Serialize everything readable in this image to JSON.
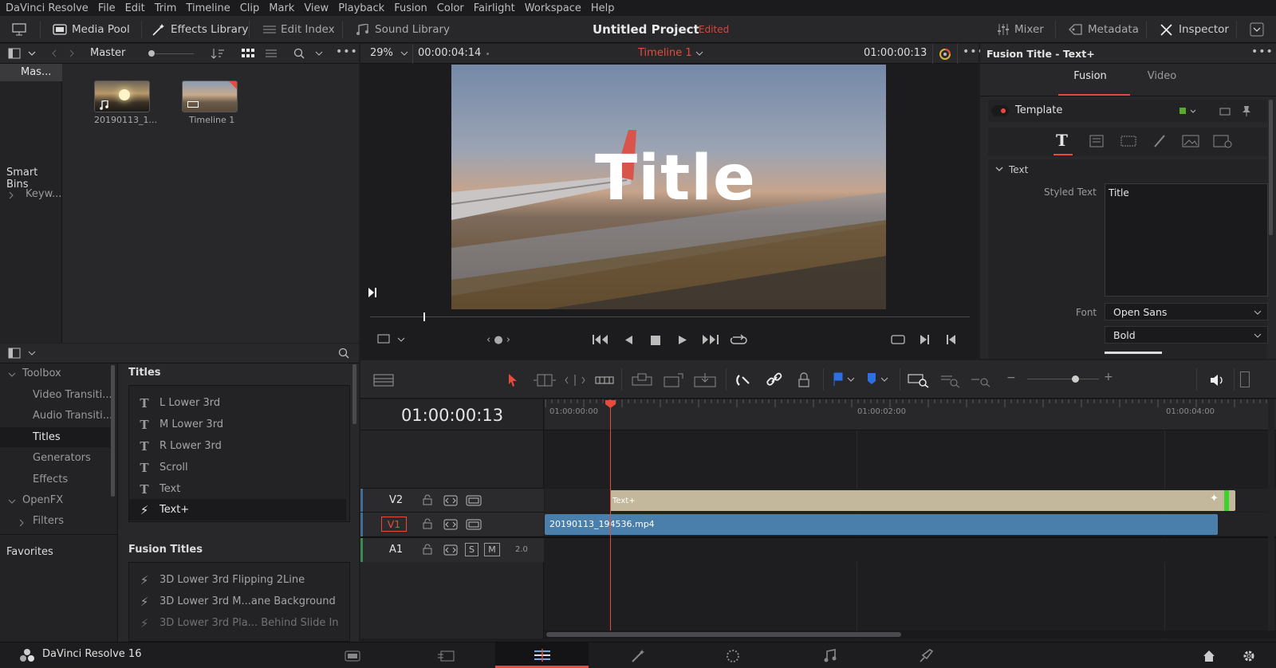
{
  "menu": [
    "DaVinci Resolve",
    "File",
    "Edit",
    "Trim",
    "Timeline",
    "Clip",
    "Mark",
    "View",
    "Playback",
    "Fusion",
    "Color",
    "Fairlight",
    "Workspace",
    "Help"
  ],
  "toolbar": {
    "media_pool": "Media Pool",
    "effects_library": "Effects Library",
    "edit_index": "Edit Index",
    "sound_library": "Sound Library",
    "project_title": "Untitled Project",
    "project_status": "Edited",
    "mixer": "Mixer",
    "metadata": "Metadata",
    "inspector": "Inspector"
  },
  "media_pool": {
    "bin_label": "Master",
    "tree_master": "Mas...",
    "smart_bins": "Smart Bins",
    "keywords": "Keyw...",
    "clips": [
      {
        "name": "20190113_1..."
      },
      {
        "name": "Timeline 1"
      }
    ]
  },
  "viewer": {
    "zoom": "29%",
    "source_timecode": "00:00:04:14",
    "timeline_name": "Timeline 1",
    "record_timecode": "01:00:00:13",
    "overlay_title": "Title"
  },
  "effects_library": {
    "toolbox": "Toolbox",
    "tree": [
      "Video Transiti...",
      "Audio Transiti...",
      "Titles",
      "Generators",
      "Effects"
    ],
    "openfx": "OpenFX",
    "filters": "Filters",
    "favorites": "Favorites",
    "titles_heading": "Titles",
    "titles": [
      "L Lower 3rd",
      "M Lower 3rd",
      "R Lower 3rd",
      "Scroll",
      "Text",
      "Text+"
    ],
    "fusion_titles_heading": "Fusion Titles",
    "fusion_titles": [
      "3D Lower 3rd Flipping 2Line",
      "3D Lower 3rd M...ane Background",
      "3D Lower 3rd Pla... Behind Slide In"
    ]
  },
  "inspector": {
    "title": "Fusion Title - Text+",
    "tab_fusion": "Fusion",
    "tab_video": "Video",
    "template": "Template",
    "section_text": "Text",
    "styled_text_label": "Styled Text",
    "styled_text_value": "Title",
    "font_label": "Font",
    "font_value": "Open Sans",
    "style_value": "Bold"
  },
  "timeline": {
    "timecode": "01:00:00:13",
    "ruler": [
      "01:00:00:00",
      "01:00:02:00",
      "01:00:04:00"
    ],
    "tracks": [
      {
        "name": "V2"
      },
      {
        "name": "V1"
      },
      {
        "name": "A1",
        "solo": "S",
        "mute": "M",
        "level": "2.0"
      }
    ],
    "clip_v2": "Text+",
    "clip_v1": "20190113_194536.mp4"
  },
  "status": {
    "app": "DaVinci Resolve 16"
  },
  "colors": {
    "accent_red": "#e64b3c",
    "v1_clip": "#4a7fab",
    "v2_clip": "#c3b79c",
    "bg": "#28282b"
  }
}
